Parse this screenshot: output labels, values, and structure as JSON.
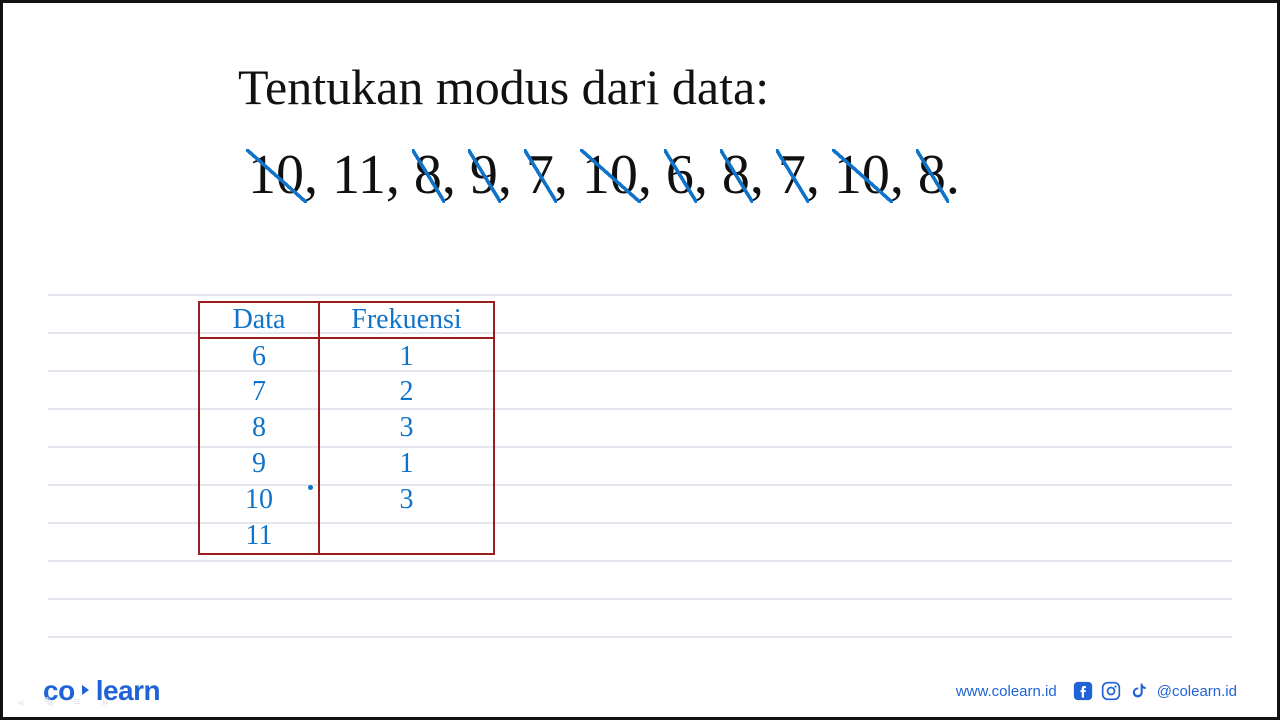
{
  "question": {
    "title": "Tentukan modus dari data:",
    "numbers": [
      {
        "value": "10",
        "struck": true
      },
      {
        "value": "11",
        "struck": false
      },
      {
        "value": "8",
        "struck": true
      },
      {
        "value": "9",
        "struck": true
      },
      {
        "value": "7",
        "struck": true
      },
      {
        "value": "10",
        "struck": true
      },
      {
        "value": "6",
        "struck": true
      },
      {
        "value": "8",
        "struck": true
      },
      {
        "value": "7",
        "struck": true
      },
      {
        "value": "10",
        "struck": true
      },
      {
        "value": "8",
        "struck": true
      }
    ],
    "terminator": "."
  },
  "table": {
    "headers": {
      "data": "Data",
      "freq": "Frekuensi"
    },
    "rows": [
      {
        "data": "6",
        "freq": "1"
      },
      {
        "data": "7",
        "freq": "2"
      },
      {
        "data": "8",
        "freq": "3"
      },
      {
        "data": "9",
        "freq": "1"
      },
      {
        "data": "10",
        "freq": "3"
      },
      {
        "data": "11",
        "freq": ""
      }
    ]
  },
  "footer": {
    "brand_a": "co",
    "brand_b": "learn",
    "website": "www.colearn.id",
    "handle": "@colearn.id"
  }
}
